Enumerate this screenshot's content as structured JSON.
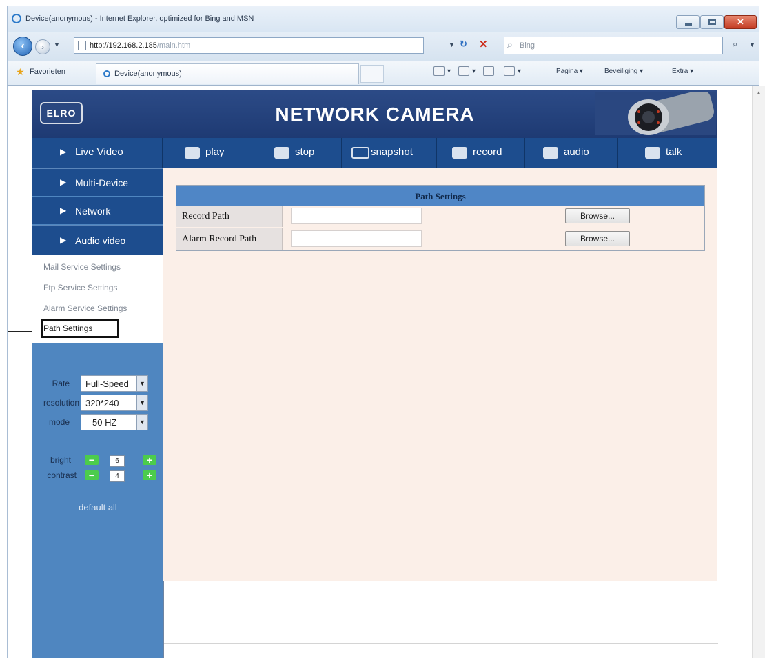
{
  "browser": {
    "title": "Device(anonymous) - Internet Explorer, optimized for Bing and MSN",
    "url_host": "http://192.168.2.185",
    "url_path": "/main.htm",
    "search_placeholder": "Bing",
    "favorites_label": "Favorieten",
    "tab_label": "Device(anonymous)",
    "cmd_pagina": "Pagina ▾",
    "cmd_beveiliging": "Beveiliging ▾",
    "cmd_extra": "Extra ▾"
  },
  "banner": {
    "logo_text": "ELRO",
    "title": "NETWORK CAMERA"
  },
  "toolbar": {
    "play": "play",
    "stop": "stop",
    "snapshot": "snapshot",
    "record": "record",
    "audio": "audio",
    "talk": "talk"
  },
  "sidebar": {
    "menu": [
      "Live Video",
      "Multi-Device",
      "Network",
      "Audio video"
    ],
    "submenu": [
      "Mail Service Settings",
      "Ftp Service Settings",
      "Alarm Service Settings",
      "Path Settings"
    ],
    "rate_label": "Rate",
    "rate_value": "Full-Speed",
    "resolution_label": "resolution",
    "resolution_value": "320*240",
    "mode_label": "mode",
    "mode_value": "50 HZ",
    "bright_label": "bright",
    "bright_value": "6",
    "contrast_label": "contrast",
    "contrast_value": "4",
    "default_all": "default all"
  },
  "path_settings": {
    "header": "Path Settings",
    "rows": [
      {
        "label": "Record Path",
        "value": "",
        "button": "Browse..."
      },
      {
        "label": "Alarm Record Path",
        "value": "",
        "button": "Browse..."
      }
    ]
  },
  "colors": {
    "banner": "#1e3a73",
    "toolbar": "#1d4d8e",
    "sidebar": "#4f86c0",
    "table_header": "#4f86c6",
    "content_bg": "#fbefe8"
  }
}
